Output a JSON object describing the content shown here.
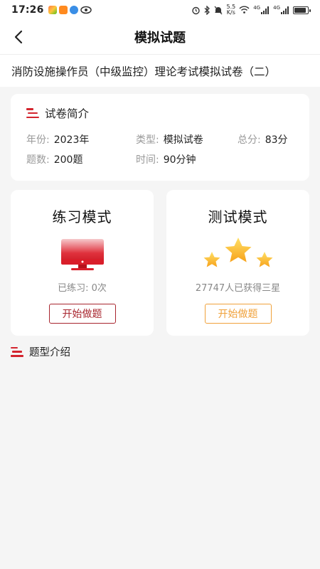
{
  "status_bar": {
    "time": "17:26",
    "speed_top": "5.5",
    "speed_bottom": "K/s",
    "signal_1": "4G",
    "signal_2": "4G",
    "battery_level": 0.9
  },
  "nav": {
    "title": "模拟试题"
  },
  "exam": {
    "title": "消防设施操作员（中级监控）理论考试模拟试卷（二）"
  },
  "intro": {
    "heading": "试卷简介",
    "year_label": "年份:",
    "year_value": "2023年",
    "type_label": "类型:",
    "type_value": "模拟试卷",
    "score_label": "总分:",
    "score_value": "83分",
    "count_label": "题数:",
    "count_value": "200题",
    "time_label": "时间:",
    "time_value": "90分钟"
  },
  "practice": {
    "title": "练习模式",
    "stat": "已练习: 0次",
    "button": "开始做题"
  },
  "test": {
    "title": "测试模式",
    "stat": "27747人已获得三星",
    "button": "开始做题"
  },
  "type_intro": {
    "heading": "题型介绍"
  },
  "colors": {
    "accent_red": "#d3242e",
    "button_red": "#a8252e",
    "button_orange": "#f0a13a",
    "background": "#f5f5f5"
  }
}
